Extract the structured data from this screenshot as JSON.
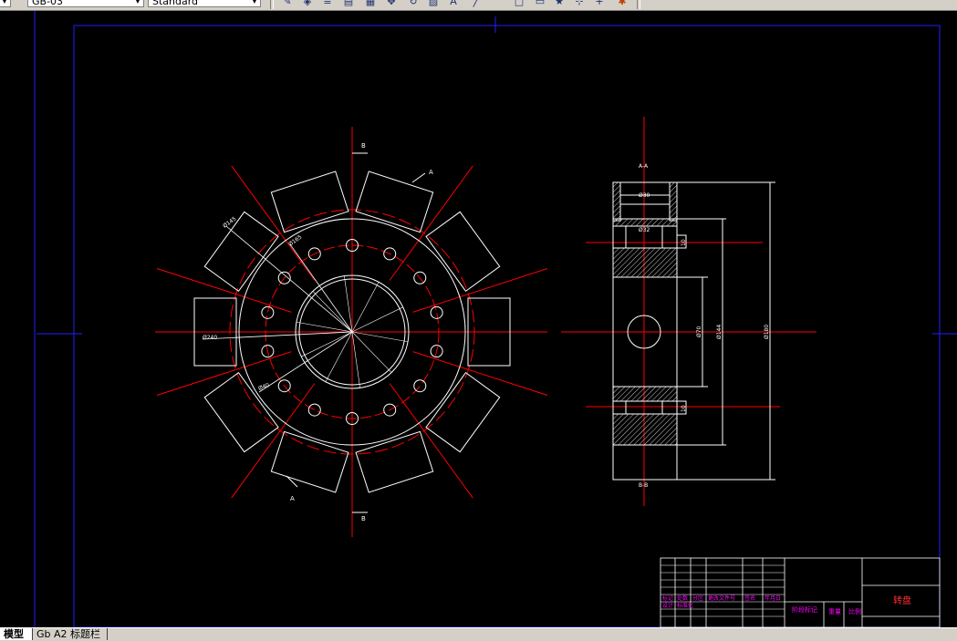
{
  "toolbar": {
    "layer_combo": "GB-03",
    "style_combo": "Standard",
    "icons": [
      "match-properties-icon",
      "paint-icon",
      "layer-icon",
      "layer-state-icon",
      "move-icon",
      "refresh-icon",
      "properties-icon",
      "line-icon",
      "rectangle-icon",
      "block-icon",
      "star-icon",
      "point-icon",
      "color-icon"
    ]
  },
  "tabs": [
    "模型",
    "Gb A2 标题栏"
  ],
  "drawing": {
    "front_view": {
      "section_marks": {
        "b_top": "B",
        "b_bottom": "B",
        "a_top": "A",
        "a_bottom": "A"
      },
      "dims": {
        "d1": "Ø145",
        "d2": "Ø165",
        "d3": "Ø240",
        "d4": "Ø40"
      }
    },
    "section_view": {
      "title_top": "A-A",
      "title_bottom": "B-B",
      "dims": {
        "top_w": "Ø30",
        "inner_w": "Ø32",
        "h1": "10",
        "h2": "10",
        "v1": "Ø70",
        "v2": "Ø144",
        "v3": "Ø180"
      }
    },
    "title_block": {
      "part_name": "转盘",
      "row1": [
        "标记",
        "处数",
        "分区",
        "更改文件号",
        "签名",
        "年月日"
      ],
      "row2": [
        "设计",
        "标准化",
        "",
        "",
        "",
        ""
      ],
      "row3": [
        "",
        "",
        "",
        "",
        "",
        ""
      ],
      "stage_label": "阶段标记",
      "weight_label": "重量",
      "scale_label": "比例",
      "review_label": "审核"
    }
  },
  "colors": {
    "background": "#000000",
    "geometry": "#ffffff",
    "centerline": "#ff0000",
    "border": "#2020ff",
    "titleblock_text": "#ff00ff",
    "part_name": "#ff2020"
  }
}
